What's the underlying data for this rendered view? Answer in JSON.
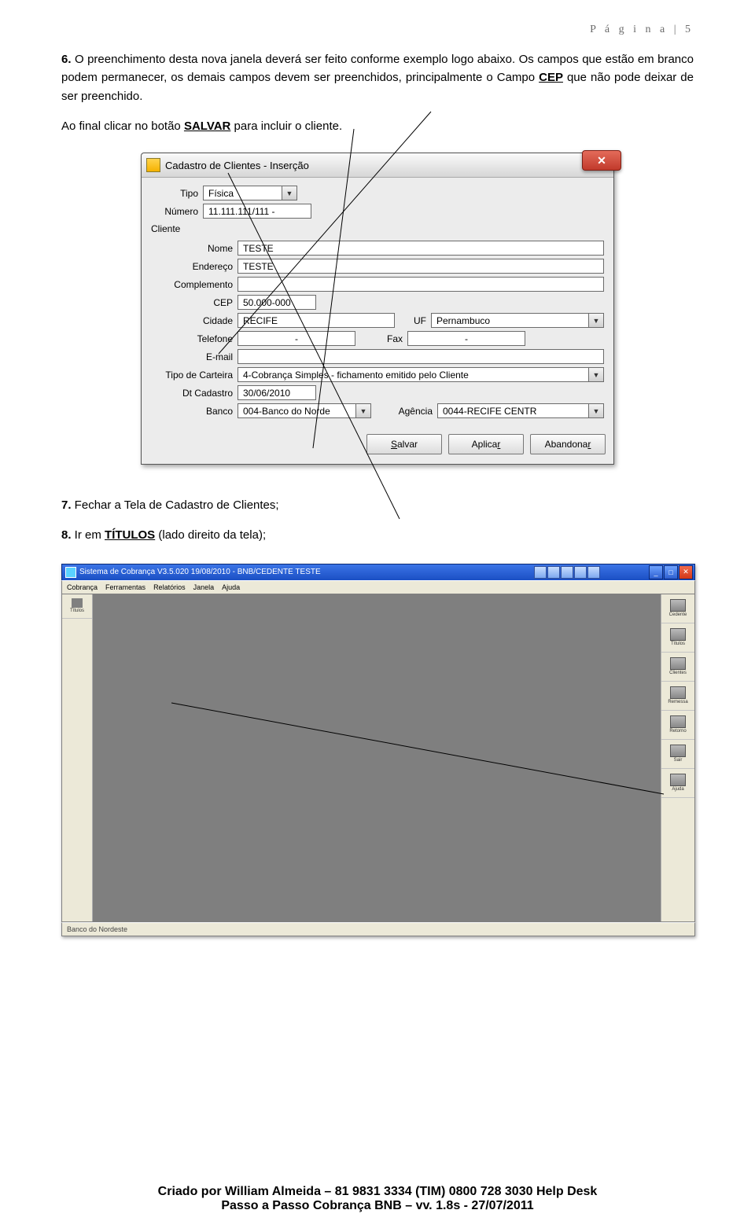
{
  "page_header": "P á g i n a  | 5",
  "para6_pre": "6.",
  "para6": " O preenchimento desta nova janela deverá ser feito conforme exemplo logo abaixo. Os campos que estão em branco podem permanecer, os demais campos devem ser preenchidos, principalmente o Campo ",
  "para6_cep": "CEP",
  "para6_after": " que não pode deixar de ser preenchido.",
  "para6_line2_pre": "Ao final clicar no botão ",
  "para6_line2_bold": "SALVAR",
  "para6_line2_after": " para incluir o cliente.",
  "dialog": {
    "title": "Cadastro de Clientes - Inserção",
    "labels": {
      "tipo": "Tipo",
      "numero": "Número",
      "cliente": "Cliente",
      "nome": "Nome",
      "endereco": "Endereço",
      "complemento": "Complemento",
      "cep": "CEP",
      "cidade": "Cidade",
      "uf": "UF",
      "telefone": "Telefone",
      "fax": "Fax",
      "email": "E-mail",
      "tipo_carteira": "Tipo de Carteira",
      "dt_cadastro": "Dt Cadastro",
      "banco": "Banco",
      "agencia": "Agência"
    },
    "values": {
      "tipo": "Física",
      "numero": "11.111.111/111 -",
      "nome": "TESTE",
      "endereco": "TESTE",
      "complemento": "",
      "cep": "50.000-000",
      "cidade": "RECIFE",
      "uf": "Pernambuco",
      "telefone": "-",
      "fax": "-",
      "email": "",
      "tipo_carteira": "4-Cobrança Simples - fichamento emitido pelo Cliente",
      "dt_cadastro": "30/06/2010",
      "banco": "004-Banco do Norde",
      "agencia": "0044-RECIFE CENTR"
    },
    "buttons": {
      "salvar_pre": "S",
      "salvar_rest": "alvar",
      "aplicar_pre": "Aplica",
      "aplicar_rest": "r",
      "abandonar_pre": "Abandona",
      "abandonar_rest": "r"
    }
  },
  "para7_pre": "7.",
  "para7": " Fechar a Tela de Cadastro de Clientes;",
  "para8_pre": "8.",
  "para8_a": " Ir em ",
  "para8_bold": "TÍTULOS",
  "para8_b": " (lado direito da tela);",
  "mdi": {
    "title": "Sistema de Cobrança V3.5.020 19/08/2010 - BNB/CEDENTE TESTE",
    "menus": [
      "Cobrança",
      "Ferramentas",
      "Relatórios",
      "Janela",
      "Ajuda"
    ],
    "left": [
      "Títulos"
    ],
    "right": [
      "Cedente",
      "Títulos",
      "Clientes",
      "Remessa",
      "Retorno",
      "Sair",
      "Ajuda"
    ],
    "status": "Banco do Nordeste"
  },
  "footer": {
    "line1": "Criado por William Almeida – 81 9831 3334 (TIM)  0800 728 3030 Help Desk",
    "line2": "Passo a Passo Cobrança BNB – vv. 1.8s - 27/07/2011"
  }
}
